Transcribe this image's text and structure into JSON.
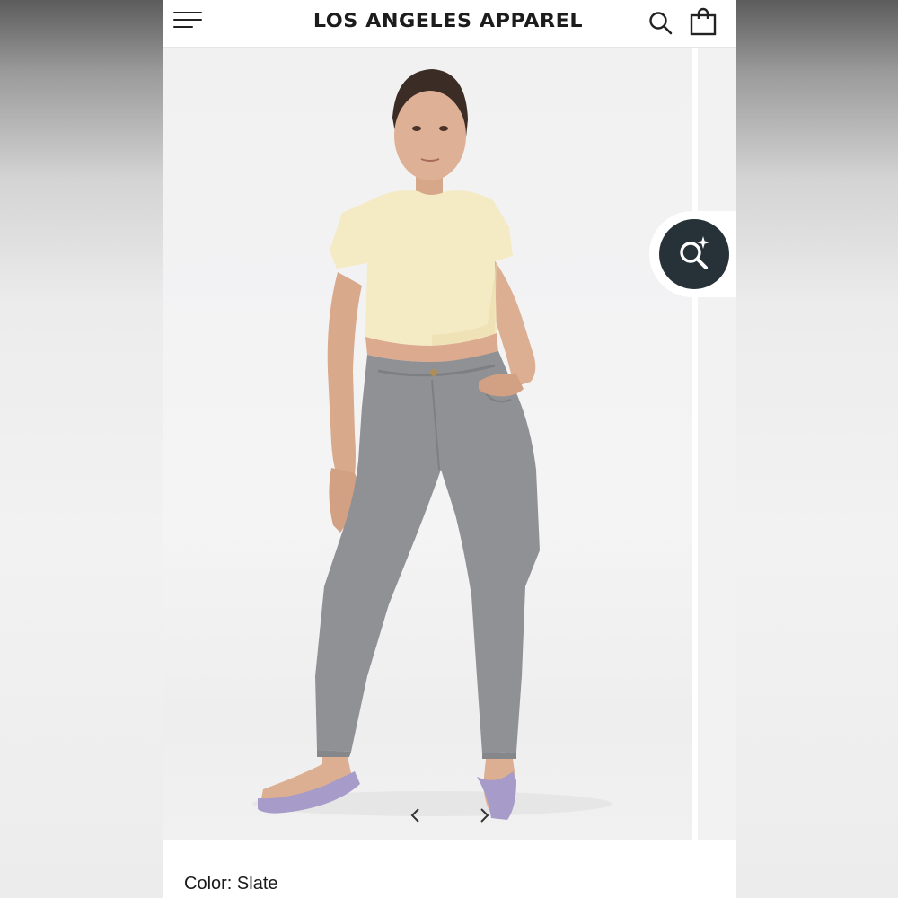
{
  "header": {
    "brand": "LOS ANGELES APPAREL",
    "menu_icon": "hamburger-menu-icon",
    "search_icon": "search-icon",
    "cart_icon": "shopping-bag-icon"
  },
  "gallery": {
    "image_subject": "model-in-cream-crop-tee-and-slate-jeans",
    "zoom_icon": "magnify-sparkle-icon",
    "prev_icon": "chevron-left-icon",
    "next_icon": "chevron-right-icon"
  },
  "product": {
    "color_label": "Color:",
    "color_value": "Slate"
  },
  "colors": {
    "zoom_button": "#263238",
    "shirt": "#f5ebc4",
    "jeans": "#8e9094",
    "shoes": "#a49ac8"
  }
}
